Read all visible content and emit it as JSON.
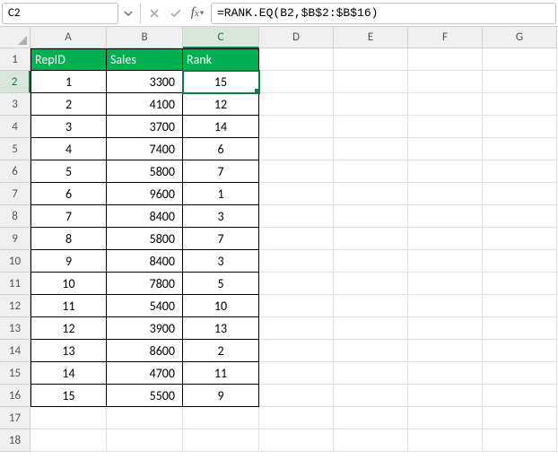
{
  "nameBox": {
    "value": "C2"
  },
  "formulaBar": {
    "value": "=RANK.EQ(B2,$B$2:$B$16)"
  },
  "columns": [
    "A",
    "B",
    "C",
    "D",
    "E",
    "F",
    "G"
  ],
  "activeCol": "C",
  "activeRow": 2,
  "rowCount": 18,
  "headers": {
    "A": "RepID",
    "B": "Sales",
    "C": "Rank"
  },
  "table": [
    {
      "RepID": "1",
      "Sales": "3300",
      "Rank": "15"
    },
    {
      "RepID": "2",
      "Sales": "4100",
      "Rank": "12"
    },
    {
      "RepID": "3",
      "Sales": "3700",
      "Rank": "14"
    },
    {
      "RepID": "4",
      "Sales": "7400",
      "Rank": "6"
    },
    {
      "RepID": "5",
      "Sales": "5800",
      "Rank": "7"
    },
    {
      "RepID": "6",
      "Sales": "9600",
      "Rank": "1"
    },
    {
      "RepID": "7",
      "Sales": "8400",
      "Rank": "3"
    },
    {
      "RepID": "8",
      "Sales": "5800",
      "Rank": "7"
    },
    {
      "RepID": "9",
      "Sales": "8400",
      "Rank": "3"
    },
    {
      "RepID": "10",
      "Sales": "7800",
      "Rank": "5"
    },
    {
      "RepID": "11",
      "Sales": "5400",
      "Rank": "10"
    },
    {
      "RepID": "12",
      "Sales": "3900",
      "Rank": "13"
    },
    {
      "RepID": "13",
      "Sales": "8600",
      "Rank": "2"
    },
    {
      "RepID": "14",
      "Sales": "4700",
      "Rank": "11"
    },
    {
      "RepID": "15",
      "Sales": "5500",
      "Rank": "9"
    }
  ]
}
